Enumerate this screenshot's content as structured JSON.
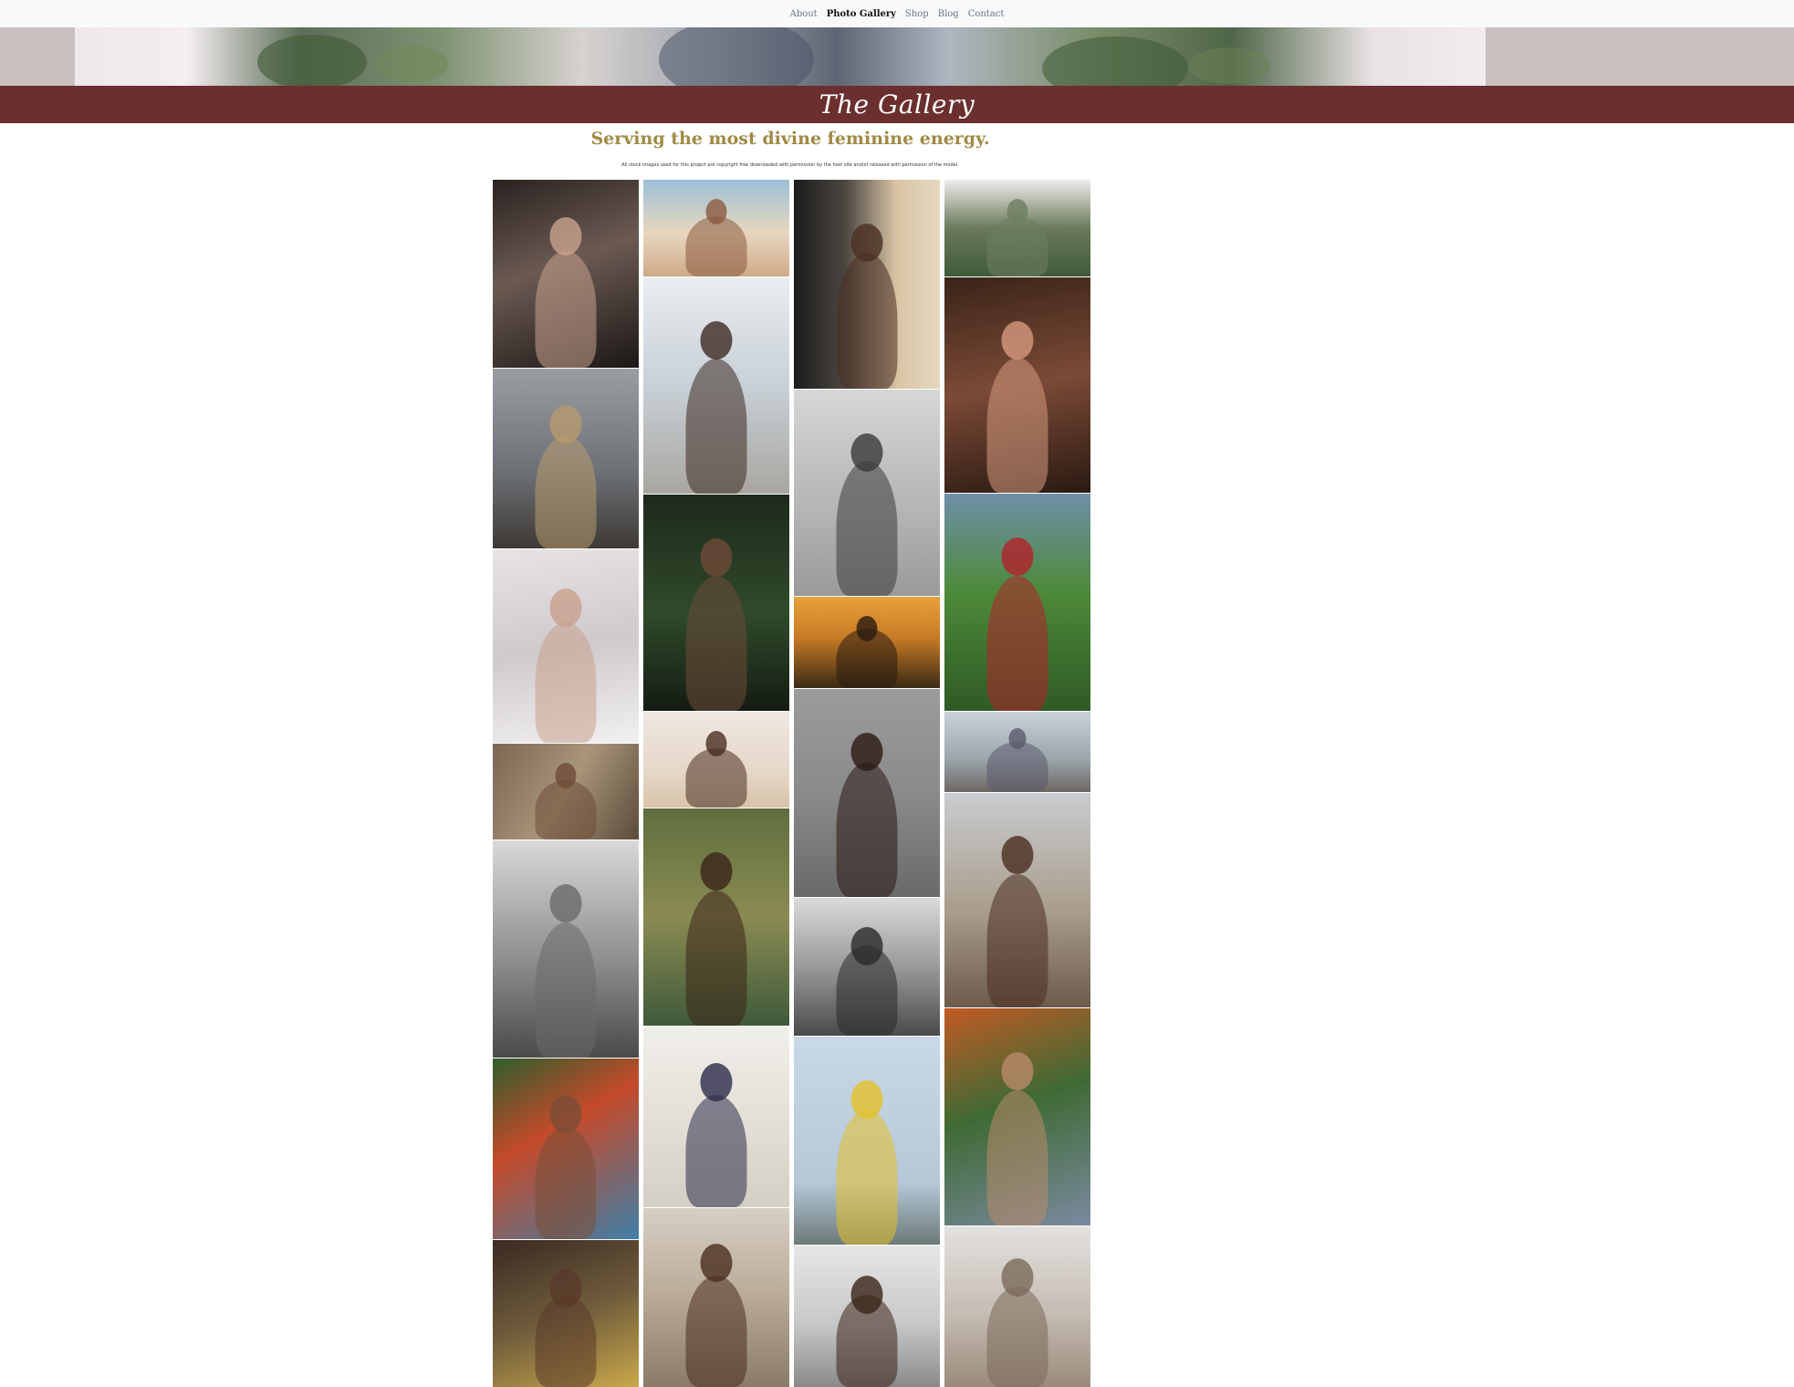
{
  "nav": {
    "items": [
      {
        "label": "About",
        "active": false
      },
      {
        "label": "Photo Gallery",
        "active": true
      },
      {
        "label": "Shop",
        "active": false
      },
      {
        "label": "Blog",
        "active": false
      },
      {
        "label": "Contact",
        "active": false
      }
    ]
  },
  "banner": {
    "title": "The Gallery",
    "color": "#6b2f2f"
  },
  "tagline": "Serving the most divine feminine energy.",
  "credit": "All stock images used for this project are copyright free downloaded with permission by the host site and/or released with permission of the model.",
  "colors": {
    "tagline": "#a08a44",
    "nav_bg": "#f8f9fa"
  },
  "gallery": {
    "columns": [
      [
        {
          "bg": "linear-gradient(160deg,#2a2220,#6b5a52 45%,#1b1716)",
          "tone": "#c9a38e"
        },
        {
          "bg": "linear-gradient(180deg,#9a9ea3,#6f7378 55%,#3e3a36)",
          "tone": "#b89a6e"
        },
        {
          "bg": "linear-gradient(170deg,#e8e4e6,#cfcacc 50%,#f2f0f1)",
          "tone": "#c8a08c"
        },
        {
          "bg": "linear-gradient(120deg,#7b6652,#a89579 50%,#5c4a3a)",
          "tone": "#6d4b37"
        },
        {
          "bg": "linear-gradient(180deg,#d9d9d9,#8e8e8e 55%,#4a4a4a)",
          "tone": "#6a6a6a"
        },
        {
          "bg": "linear-gradient(150deg,#2f5d2c,#c44a2a 40%,#3f7fa8)",
          "tone": "#7a4e36"
        },
        {
          "bg": "linear-gradient(160deg,#3a2a22,#6e5b3b 50%,#c9a84a)",
          "tone": "#5a3a2a"
        }
      ],
      [
        {
          "bg": "linear-gradient(180deg,#9cc0d8,#e8d7c0 55%,#cfa987)",
          "tone": "#8b5a3e"
        },
        {
          "bg": "linear-gradient(180deg,#e9eef1,#c8d0d6 50%,#a9a6a0)",
          "tone": "#3c2a22"
        },
        {
          "bg": "linear-gradient(180deg,#1e2a1c,#2f4a2a 55%,#141c12)",
          "tone": "#6e4a38"
        },
        {
          "bg": "linear-gradient(180deg,#efe8e2,#e6d8c9 60%,#d8c4a8)",
          "tone": "#4a2e20"
        },
        {
          "bg": "linear-gradient(180deg,#5f6e3e,#8a8b52 50%,#3f5a3a)",
          "tone": "#3a2418"
        },
        {
          "bg": "linear-gradient(180deg,#f1efea,#e1ddd4 60%,#d4cfc4)",
          "tone": "#2b2b4a"
        },
        {
          "bg": "linear-gradient(180deg,#d7cfc5,#b9aa96 50%,#8a7a68)",
          "tone": "#4a2e1e"
        }
      ],
      [
        {
          "bg": "linear-gradient(90deg,#1c1c1c,#4b4640 35%,#d8c4a4 70%,#e6d8c0)",
          "tone": "#4a2e22"
        },
        {
          "bg": "linear-gradient(180deg,#d6d6d6,#b4b4b4 60%,#9a9a9a)",
          "tone": "#3a3a3a"
        },
        {
          "bg": "linear-gradient(180deg,#e8a23a,#c77a25 45%,#3a2a14)",
          "tone": "#2a1c12"
        },
        {
          "bg": "linear-gradient(180deg,#9c9c9c,#8a8a8a 50%,#6a6a6a)",
          "tone": "#2a1a14"
        },
        {
          "bg": "linear-gradient(180deg,#dadada,#9a9a9a 50%,#4a4a4a)",
          "tone": "#2a2a2a"
        },
        {
          "bg": "linear-gradient(180deg,#c9d8e6,#b6c8d8 70%,#6c7a78)",
          "tone": "#e3c12a"
        },
        {
          "bg": "linear-gradient(180deg,#e6e6e6,#c8c8c8 55%,#8a8a8a)",
          "tone": "#3a2418"
        }
      ],
      [
        {
          "bg": "linear-gradient(180deg,#f0ecec,#6a7a5a 50%,#3f5a3a)",
          "tone": "#6e8062"
        },
        {
          "bg": "linear-gradient(170deg,#3a2418,#7b4a36 50%,#2a1a12)",
          "tone": "#d69a80"
        },
        {
          "bg": "linear-gradient(180deg,#6f8fa8,#4d8a3a 45%,#2f5a24)",
          "tone": "#b3222a"
        },
        {
          "bg": "linear-gradient(180deg,#c9d2d8,#9aa4aa 60%,#6e6662)",
          "tone": "#5a5a6a"
        },
        {
          "bg": "linear-gradient(180deg,#c9cccf,#a99d8c 55%,#6c5a4a)",
          "tone": "#4a2e20"
        },
        {
          "bg": "linear-gradient(160deg,#c25a24,#3f6a34 45%,#7a8aa0)",
          "tone": "#b98a6a"
        },
        {
          "bg": "linear-gradient(180deg,#e3e1de,#c5bcb2 55%,#9a8a7a)",
          "tone": "#7a6a5a"
        }
      ]
    ]
  }
}
